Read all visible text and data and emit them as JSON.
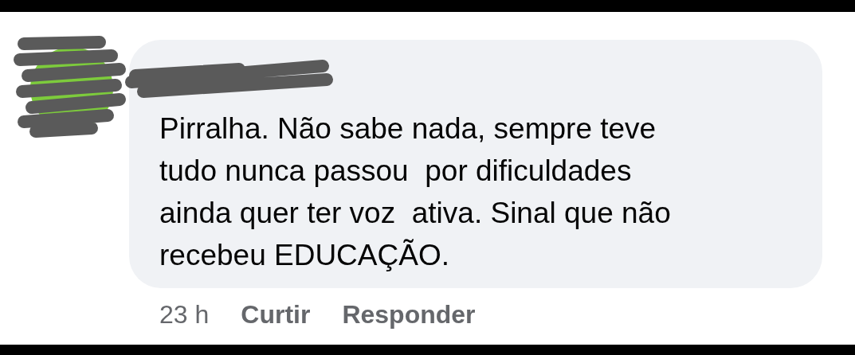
{
  "comment": {
    "text": "Pirralha. Não sabe nada, sempre teve\ntudo nunca passou  por dificuldades\nainda quer ter voz  ativa. Sinal que não\nrecebeu EDUCAÇÃO.",
    "time": "23 h",
    "actions": [
      "Curtir",
      "Responder"
    ]
  }
}
